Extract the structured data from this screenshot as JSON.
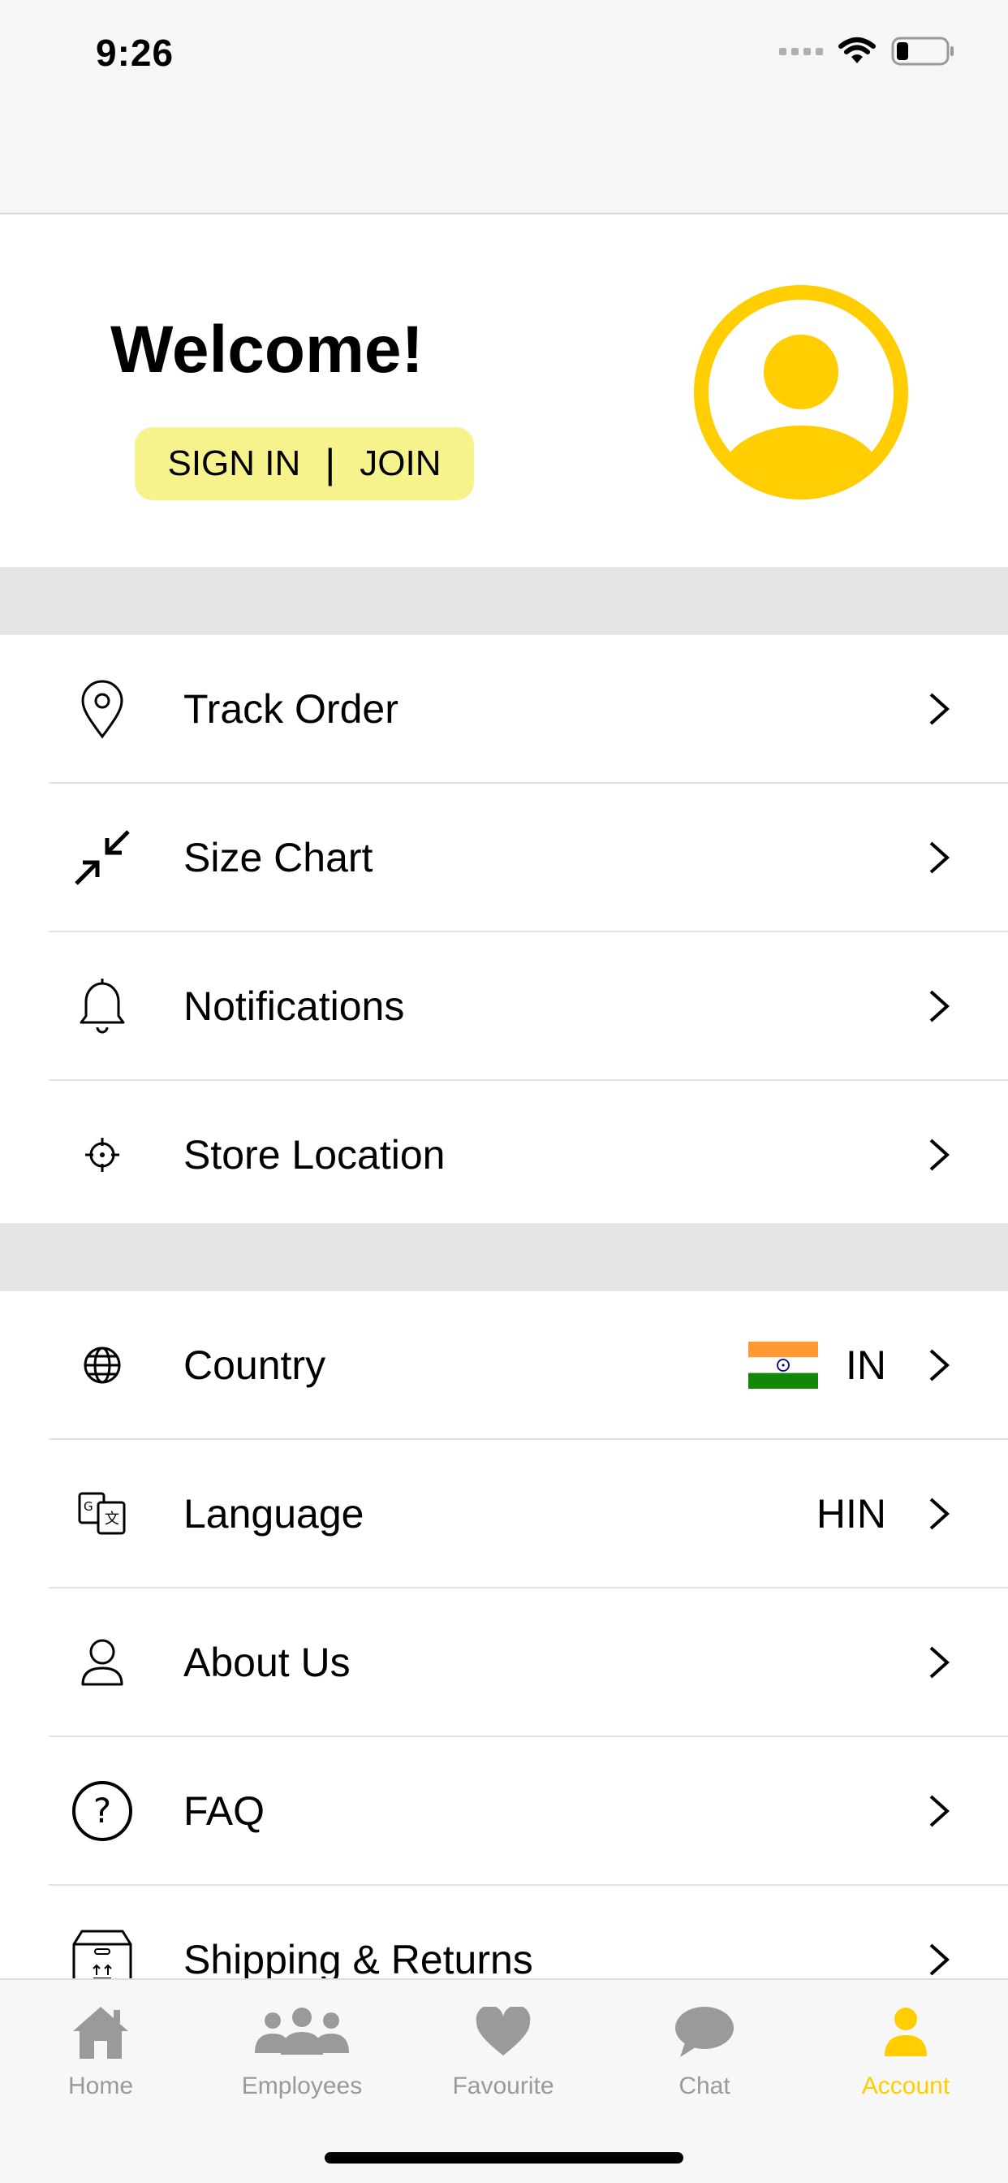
{
  "status_bar": {
    "time": "9:26"
  },
  "header": {
    "welcome": "Welcome!",
    "sign_in": "SIGN IN",
    "separator": "|",
    "join": "JOIN"
  },
  "menu_group_1": [
    {
      "label": "Track Order",
      "icon": "location-pin-icon"
    },
    {
      "label": "Size Chart",
      "icon": "arrows-collapse-icon"
    },
    {
      "label": "Notifications",
      "icon": "bell-icon"
    },
    {
      "label": "Store Location",
      "icon": "crosshair-icon"
    }
  ],
  "menu_group_2": [
    {
      "label": "Country",
      "icon": "globe-icon",
      "value": "IN"
    },
    {
      "label": "Language",
      "icon": "translate-icon",
      "value": "HIN"
    },
    {
      "label": "About Us",
      "icon": "user-outline-icon"
    },
    {
      "label": "FAQ",
      "icon": "question-circle-icon"
    },
    {
      "label": "Shipping & Returns",
      "icon": "box-icon"
    }
  ],
  "tabbar": {
    "items": [
      {
        "label": "Home",
        "icon": "home-icon"
      },
      {
        "label": "Employees",
        "icon": "people-group-icon"
      },
      {
        "label": "Favourite",
        "icon": "heart-icon"
      },
      {
        "label": "Chat",
        "icon": "chat-bubble-icon"
      },
      {
        "label": "Account",
        "icon": "person-icon",
        "active": true
      }
    ]
  },
  "colors": {
    "accent": "#ffcd00",
    "pill": "#f7f38c",
    "separator": "#e4e4e4",
    "inactive": "#9a9a9a"
  }
}
